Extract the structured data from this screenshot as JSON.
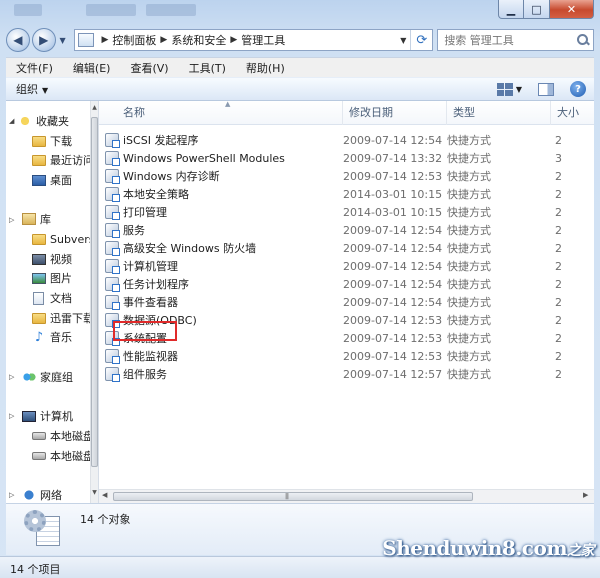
{
  "window": {
    "controls": {
      "minimize": "▁",
      "maximize": "□",
      "close": "✕"
    }
  },
  "nav": {
    "back": "◀",
    "forward": "▶",
    "breadcrumbs": [
      "控制面板",
      "系统和安全",
      "管理工具"
    ],
    "search_placeholder": "搜索 管理工具"
  },
  "menubar": {
    "items": [
      "文件(F)",
      "编辑(E)",
      "查看(V)",
      "工具(T)",
      "帮助(H)"
    ]
  },
  "commandbar": {
    "organize": "组织",
    "help": "?"
  },
  "navpane": {
    "items": [
      {
        "label": "收藏夹",
        "icon": "star-icon"
      },
      {
        "label": "下载",
        "icon": "folder-icon"
      },
      {
        "label": "最近访问",
        "icon": "folder-icon"
      },
      {
        "label": "桌面",
        "icon": "desktop-icon"
      },
      {
        "label": "库",
        "icon": "library-icon"
      },
      {
        "label": "Subvers",
        "icon": "folder-icon"
      },
      {
        "label": "视频",
        "icon": "video-icon"
      },
      {
        "label": "图片",
        "icon": "picture-icon"
      },
      {
        "label": "文档",
        "icon": "document-icon"
      },
      {
        "label": "迅雷下载",
        "icon": "folder-icon"
      },
      {
        "label": "音乐",
        "icon": "music-icon"
      },
      {
        "label": "家庭组",
        "icon": "homegroup-icon"
      },
      {
        "label": "计算机",
        "icon": "computer-icon"
      },
      {
        "label": "本地磁盘",
        "icon": "disk-icon"
      },
      {
        "label": "本地磁盘",
        "icon": "disk-icon"
      },
      {
        "label": "网络",
        "icon": "network-icon"
      }
    ]
  },
  "filelist": {
    "columns": {
      "name": "名称",
      "date": "修改日期",
      "type": "类型",
      "size": "大小"
    },
    "rows": [
      {
        "name": "iSCSI 发起程序",
        "date": "2009-07-14 12:54",
        "type": "快捷方式",
        "size": "2"
      },
      {
        "name": "Windows PowerShell Modules",
        "date": "2009-07-14 13:32",
        "type": "快捷方式",
        "size": "3"
      },
      {
        "name": "Windows 内存诊断",
        "date": "2009-07-14 12:53",
        "type": "快捷方式",
        "size": "2"
      },
      {
        "name": "本地安全策略",
        "date": "2014-03-01 10:15",
        "type": "快捷方式",
        "size": "2"
      },
      {
        "name": "打印管理",
        "date": "2014-03-01 10:15",
        "type": "快捷方式",
        "size": "2"
      },
      {
        "name": "服务",
        "date": "2009-07-14 12:54",
        "type": "快捷方式",
        "size": "2"
      },
      {
        "name": "高级安全 Windows 防火墙",
        "date": "2009-07-14 12:54",
        "type": "快捷方式",
        "size": "2"
      },
      {
        "name": "计算机管理",
        "date": "2009-07-14 12:54",
        "type": "快捷方式",
        "size": "2"
      },
      {
        "name": "任务计划程序",
        "date": "2009-07-14 12:54",
        "type": "快捷方式",
        "size": "2"
      },
      {
        "name": "事件查看器",
        "date": "2009-07-14 12:54",
        "type": "快捷方式",
        "size": "2"
      },
      {
        "name": "数据源(ODBC)",
        "date": "2009-07-14 12:53",
        "type": "快捷方式",
        "size": "2"
      },
      {
        "name": "系统配置",
        "date": "2009-07-14 12:53",
        "type": "快捷方式",
        "size": "2"
      },
      {
        "name": "性能监视器",
        "date": "2009-07-14 12:53",
        "type": "快捷方式",
        "size": "2"
      },
      {
        "name": "组件服务",
        "date": "2009-07-14 12:57",
        "type": "快捷方式",
        "size": "2"
      }
    ]
  },
  "details": {
    "count": "14 个对象"
  },
  "status": {
    "text": "14 个项目"
  },
  "watermark": {
    "main": "Shenduwin8.com",
    "accent": "之家"
  },
  "colors": {
    "highlight": "#e02a2a",
    "accent": "#2f73c9"
  }
}
